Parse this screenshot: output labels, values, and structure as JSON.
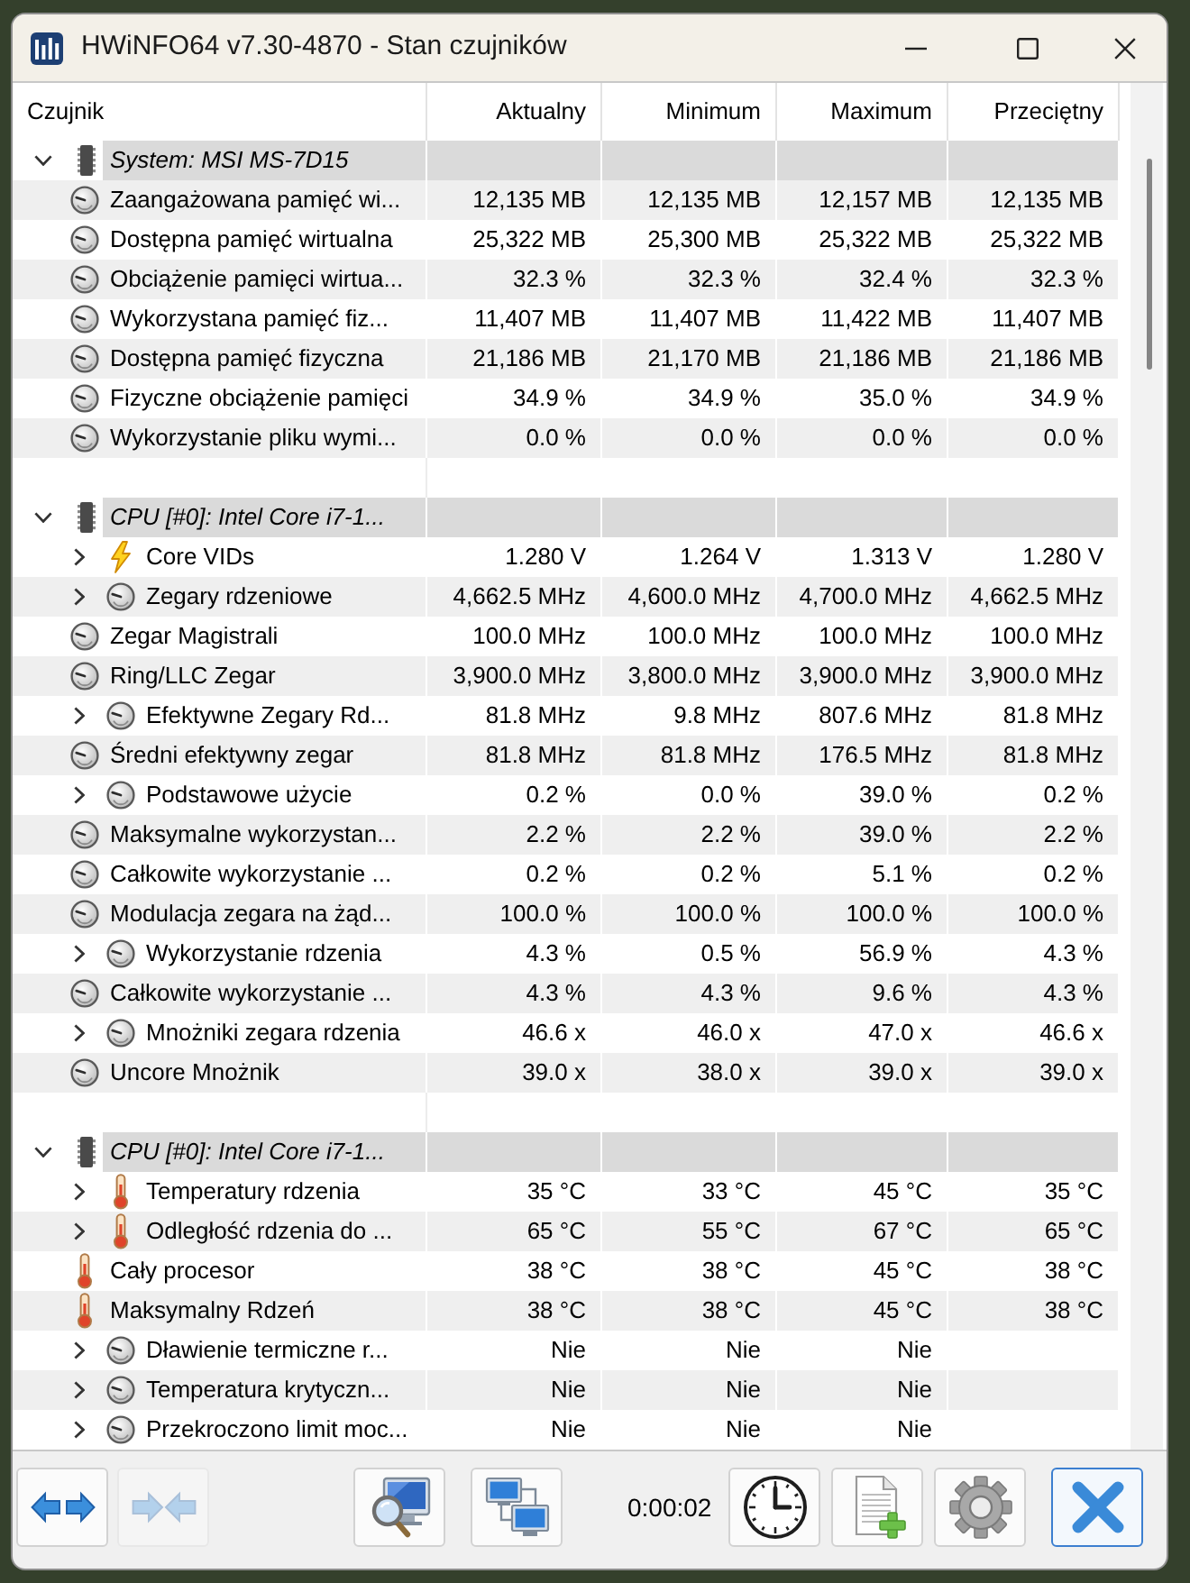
{
  "window": {
    "title": "HWiNFO64 v7.30-4870 - Stan czujników"
  },
  "table": {
    "columns": [
      "Czujnik",
      "Aktualny",
      "Minimum",
      "Maximum",
      "Przeciętny"
    ],
    "groups": [
      {
        "title": "System: MSI MS-7D15",
        "expanded": true,
        "sensors": [
          {
            "name": "Zaangażowana pamięć wi...",
            "kind": "generic",
            "expandable": false,
            "values": [
              "12,135 MB",
              "12,135 MB",
              "12,157 MB",
              "12,135 MB"
            ]
          },
          {
            "name": "Dostępna pamięć wirtualna",
            "kind": "generic",
            "expandable": false,
            "values": [
              "25,322 MB",
              "25,300 MB",
              "25,322 MB",
              "25,322 MB"
            ]
          },
          {
            "name": "Obciążenie pamięci wirtua...",
            "kind": "generic",
            "expandable": false,
            "values": [
              "32.3 %",
              "32.3 %",
              "32.4 %",
              "32.3 %"
            ]
          },
          {
            "name": "Wykorzystana pamięć fiz...",
            "kind": "generic",
            "expandable": false,
            "values": [
              "11,407 MB",
              "11,407 MB",
              "11,422 MB",
              "11,407 MB"
            ]
          },
          {
            "name": "Dostępna pamięć fizyczna",
            "kind": "generic",
            "expandable": false,
            "values": [
              "21,186 MB",
              "21,170 MB",
              "21,186 MB",
              "21,186 MB"
            ]
          },
          {
            "name": "Fizyczne obciążenie pamięci",
            "kind": "generic",
            "expandable": false,
            "values": [
              "34.9 %",
              "34.9 %",
              "35.0 %",
              "34.9 %"
            ]
          },
          {
            "name": "Wykorzystanie pliku wymi...",
            "kind": "generic",
            "expandable": false,
            "values": [
              "0.0 %",
              "0.0 %",
              "0.0 %",
              "0.0 %"
            ]
          }
        ]
      },
      {
        "title": "CPU [#0]: Intel Core i7-1...",
        "expanded": true,
        "sensors": [
          {
            "name": "Core VIDs",
            "kind": "voltage",
            "expandable": true,
            "values": [
              "1.280 V",
              "1.264 V",
              "1.313 V",
              "1.280 V"
            ]
          },
          {
            "name": "Zegary rdzeniowe",
            "kind": "generic",
            "expandable": true,
            "values": [
              "4,662.5 MHz",
              "4,600.0 MHz",
              "4,700.0 MHz",
              "4,662.5 MHz"
            ]
          },
          {
            "name": "Zegar Magistrali",
            "kind": "generic",
            "expandable": false,
            "values": [
              "100.0 MHz",
              "100.0 MHz",
              "100.0 MHz",
              "100.0 MHz"
            ]
          },
          {
            "name": "Ring/LLC Zegar",
            "kind": "generic",
            "expandable": false,
            "values": [
              "3,900.0 MHz",
              "3,800.0 MHz",
              "3,900.0 MHz",
              "3,900.0 MHz"
            ]
          },
          {
            "name": "Efektywne Zegary Rd...",
            "kind": "generic",
            "expandable": true,
            "values": [
              "81.8 MHz",
              "9.8 MHz",
              "807.6 MHz",
              "81.8 MHz"
            ]
          },
          {
            "name": "Średni efektywny zegar",
            "kind": "generic",
            "expandable": false,
            "values": [
              "81.8 MHz",
              "81.8 MHz",
              "176.5 MHz",
              "81.8 MHz"
            ]
          },
          {
            "name": "Podstawowe użycie",
            "kind": "generic",
            "expandable": true,
            "values": [
              "0.2 %",
              "0.0 %",
              "39.0 %",
              "0.2 %"
            ]
          },
          {
            "name": "Maksymalne wykorzystan...",
            "kind": "generic",
            "expandable": false,
            "values": [
              "2.2 %",
              "2.2 %",
              "39.0 %",
              "2.2 %"
            ]
          },
          {
            "name": "Całkowite wykorzystanie ...",
            "kind": "generic",
            "expandable": false,
            "values": [
              "0.2 %",
              "0.2 %",
              "5.1 %",
              "0.2 %"
            ]
          },
          {
            "name": "Modulacja zegara na żąd...",
            "kind": "generic",
            "expandable": false,
            "values": [
              "100.0 %",
              "100.0 %",
              "100.0 %",
              "100.0 %"
            ]
          },
          {
            "name": "Wykorzystanie rdzenia",
            "kind": "generic",
            "expandable": true,
            "values": [
              "4.3 %",
              "0.5 %",
              "56.9 %",
              "4.3 %"
            ]
          },
          {
            "name": "Całkowite wykorzystanie ...",
            "kind": "generic",
            "expandable": false,
            "values": [
              "4.3 %",
              "4.3 %",
              "9.6 %",
              "4.3 %"
            ]
          },
          {
            "name": "Mnożniki zegara rdzenia",
            "kind": "generic",
            "expandable": true,
            "values": [
              "46.6 x",
              "46.0 x",
              "47.0 x",
              "46.6 x"
            ]
          },
          {
            "name": "Uncore Mnożnik",
            "kind": "generic",
            "expandable": false,
            "values": [
              "39.0 x",
              "38.0 x",
              "39.0 x",
              "39.0 x"
            ]
          }
        ]
      },
      {
        "title": "CPU [#0]: Intel Core i7-1...",
        "expanded": true,
        "sensors": [
          {
            "name": "Temperatury rdzenia",
            "kind": "temperature",
            "expandable": true,
            "values": [
              "35 °C",
              "33 °C",
              "45 °C",
              "35 °C"
            ]
          },
          {
            "name": "Odległość rdzenia do ...",
            "kind": "temperature",
            "expandable": true,
            "values": [
              "65 °C",
              "55 °C",
              "67 °C",
              "65 °C"
            ]
          },
          {
            "name": "Cały procesor",
            "kind": "temperature",
            "expandable": false,
            "values": [
              "38 °C",
              "38 °C",
              "45 °C",
              "38 °C"
            ]
          },
          {
            "name": "Maksymalny Rdzeń",
            "kind": "temperature",
            "expandable": false,
            "values": [
              "38 °C",
              "38 °C",
              "45 °C",
              "38 °C"
            ]
          },
          {
            "name": "Dławienie termiczne r...",
            "kind": "generic",
            "expandable": true,
            "values": [
              "Nie",
              "Nie",
              "Nie"
            ]
          },
          {
            "name": "Temperatura krytyczn...",
            "kind": "generic",
            "expandable": true,
            "values": [
              "Nie",
              "Nie",
              "Nie"
            ]
          },
          {
            "name": "Przekroczono limit moc...",
            "kind": "generic",
            "expandable": true,
            "values": [
              "Nie",
              "Nie",
              "Nie"
            ]
          }
        ]
      }
    ]
  },
  "toolbar": {
    "left_buttons": [
      {
        "kind": "expand",
        "disabled": false,
        "focused": false
      },
      {
        "kind": "collapse",
        "disabled": true,
        "focused": false
      }
    ],
    "middle_buttons": [
      {
        "kind": "monitor",
        "disabled": false,
        "focused": false
      },
      {
        "kind": "network",
        "disabled": false,
        "focused": false
      }
    ],
    "timer": "0:00:02",
    "right_buttons": [
      {
        "kind": "clock",
        "disabled": false,
        "focused": false
      },
      {
        "kind": "log",
        "disabled": false,
        "focused": false
      },
      {
        "kind": "settings",
        "disabled": false,
        "focused": false
      },
      {
        "kind": "close",
        "disabled": false,
        "focused": true
      }
    ]
  }
}
